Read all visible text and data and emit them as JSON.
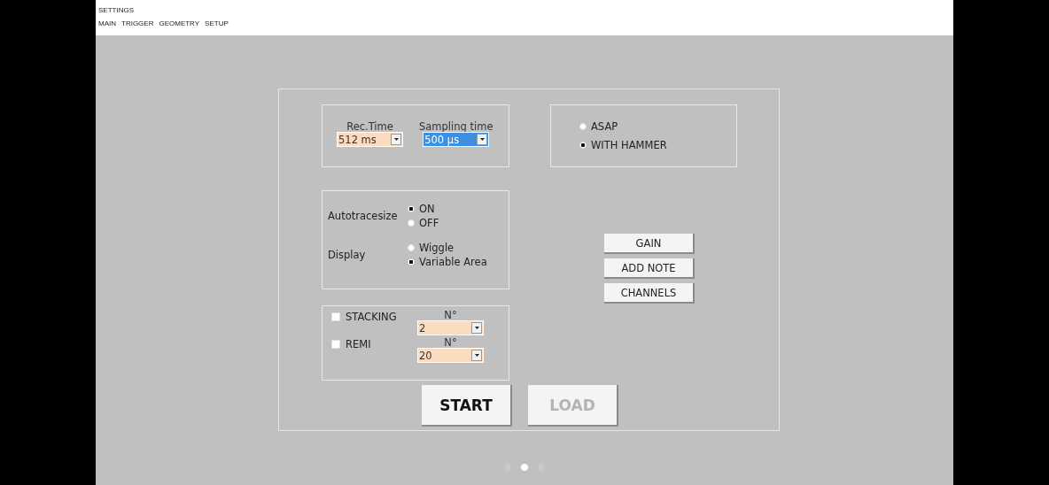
{
  "window": {
    "title": "SETTINGS"
  },
  "menu": [
    {
      "label": "MAIN"
    },
    {
      "label": "TRIGGER"
    },
    {
      "label": "GEOMETRY"
    },
    {
      "label": "SETUP"
    }
  ],
  "acquisition": [
    {
      "label": "Rec.Time",
      "value": "512 ms",
      "selected": false
    },
    {
      "label": "Sampling time",
      "value": "500 µs",
      "selected": true
    }
  ],
  "trigger": [
    {
      "label": "ASAP",
      "selected": false
    },
    {
      "label": "WITH HAMMER",
      "selected": true
    }
  ],
  "options": [
    {
      "label": "Autotracesize",
      "choices": [
        {
          "label": "ON",
          "selected": true
        },
        {
          "label": "OFF",
          "selected": false
        }
      ]
    },
    {
      "label": "Display",
      "choices": [
        {
          "label": "Wiggle",
          "selected": false
        },
        {
          "label": "Variable Area",
          "selected": true
        }
      ]
    }
  ],
  "stacking": [
    {
      "label": "STACKING",
      "checked": false,
      "count_label": "N°",
      "value": "2"
    },
    {
      "label": "REMI",
      "checked": false,
      "count_label": "N°",
      "value": "20"
    }
  ],
  "buttons": [
    "GAIN",
    "ADD NOTE",
    "CHANNELS"
  ],
  "actions": [
    {
      "label": "START",
      "disabled": false
    },
    {
      "label": "LOAD",
      "disabled": true
    }
  ],
  "pager": [
    {
      "selected": false
    },
    {
      "selected": true
    },
    {
      "selected": false
    }
  ]
}
